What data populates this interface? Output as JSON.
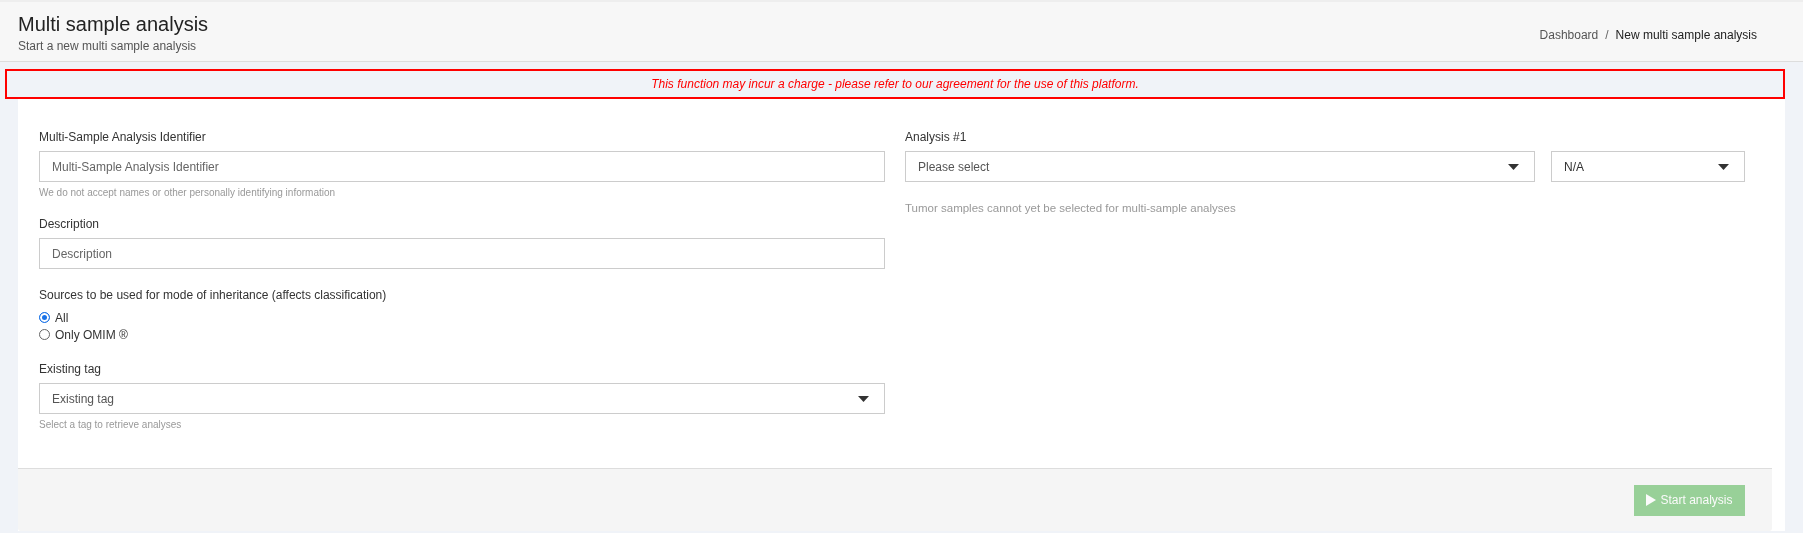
{
  "header": {
    "title": "Multi sample analysis",
    "subtitle": "Start a new multi sample analysis",
    "breadcrumb": [
      {
        "label": "Dashboard",
        "selected": false
      },
      {
        "label": "New multi sample analysis",
        "selected": true
      }
    ],
    "separator": "/"
  },
  "notice": "This function may incur a charge - please refer to our agreement for the use of this platform.",
  "left": {
    "identifier": {
      "label": "Multi-Sample Analysis Identifier",
      "placeholder": "Multi-Sample Analysis Identifier",
      "help": "We do not accept names or other personally identifying information"
    },
    "description": {
      "label": "Description",
      "placeholder": "Description"
    },
    "sources": {
      "label": "Sources to be used for mode of inheritance (affects classification)",
      "options": [
        {
          "label": "All",
          "selected": true
        },
        {
          "label": "Only OMIM ®",
          "selected": false
        }
      ]
    },
    "tag": {
      "label": "Existing tag",
      "placeholder": "Existing tag",
      "help": "Select a tag to retrieve analyses"
    }
  },
  "right": {
    "analysis": {
      "label": "Analysis #1",
      "placeholder": "Please select",
      "type_value": "N/A",
      "help": "Tumor samples cannot yet be selected for multi-sample analyses"
    }
  },
  "footer": {
    "button": {
      "label": "Start analysis",
      "disabled": true
    }
  }
}
